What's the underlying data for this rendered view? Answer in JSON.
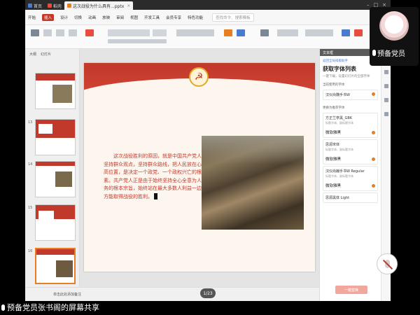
{
  "titlebar": {
    "tabs": [
      {
        "label": "首页"
      },
      {
        "label": "稻壳"
      },
      {
        "label": "这次战役为什么具有...pptx"
      }
    ]
  },
  "menu": {
    "items": [
      "开始",
      "插入",
      "设计",
      "切换",
      "动画",
      "放映",
      "审阅",
      "视图",
      "开发工具",
      "会员专享",
      "特色功能"
    ],
    "search": "查找命令、搜索模板"
  },
  "thumbnails": {
    "items": [
      {
        "num": ""
      },
      {
        "num": "13"
      },
      {
        "num": "14"
      },
      {
        "num": "15"
      },
      {
        "num": "16"
      }
    ],
    "head_tabs": [
      "大纲",
      "幻灯片"
    ]
  },
  "slide": {
    "body_text": "这次战役胜利的原因，就是中国共产党人始终坚持群众观点，坚持群众路线，把人民放在心中最高位置，是决定一个政党、一个政权兴亡的根本因素。共产党人正是由于始终坚持全心全意为人民服务的根本宗旨，始终站在最大多数人利益一边，才方能取得战役的胜利。",
    "emblem": "☭"
  },
  "right_panel": {
    "header": "文本框",
    "sub": "返回全局排版助手",
    "title": "获取字体列表",
    "desc": "一键下载，设置幻灯片的全部字体",
    "label1": "当前使用的字体",
    "label2": "更换为推荐字体",
    "fonts": [
      {
        "name": "汉仪尚魏手书W",
        "sub": "",
        "value": ""
      },
      {
        "name": "方正兰亭黑_GBK",
        "sub": "标题字体、副标题字体",
        "value": "微软雅黑"
      },
      {
        "name": "思源宋体",
        "sub": "标题字体、副标题字体",
        "value": "微软雅黑"
      },
      {
        "name": "汉仪尚巍手书W Regular",
        "sub": "标题字体、副标题字体",
        "value": "微软雅黑"
      },
      {
        "name": "思源黑体 Light",
        "sub": "",
        "value": ""
      }
    ],
    "apply": "一键替换"
  },
  "status": {
    "text": "单击此处添加备注",
    "page": "1/23"
  },
  "webcam": {
    "name": "预备党员"
  },
  "caption": {
    "text": "预备党员张书阁的屏幕共享"
  },
  "colors": {
    "accent": "#c0392b",
    "orange": "#e67e22"
  }
}
